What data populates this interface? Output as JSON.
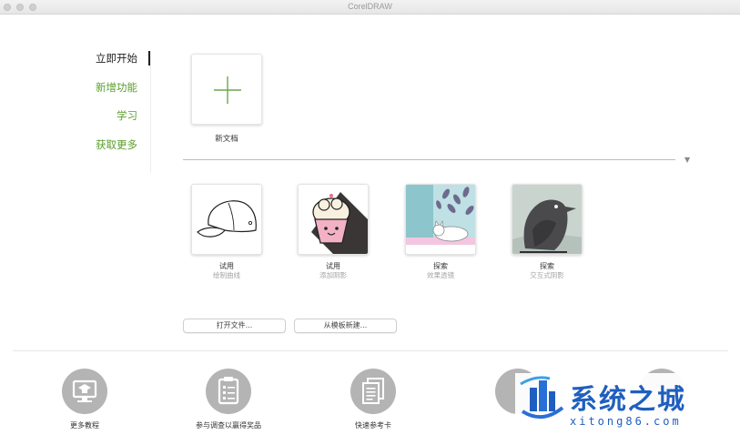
{
  "window": {
    "title": "CorelDRAW"
  },
  "nav": {
    "items": [
      {
        "label": "立即开始",
        "active": true
      },
      {
        "label": "新增功能",
        "active": false
      },
      {
        "label": "学习",
        "active": false
      },
      {
        "label": "获取更多",
        "active": false
      }
    ]
  },
  "new_document": {
    "label": "新文档",
    "icon": "plus-icon",
    "accent": "#6aa84f"
  },
  "tutorials": [
    {
      "label": "试用",
      "sublabel": "绘制曲线",
      "image": "baseball-cap-drawing"
    },
    {
      "label": "试用",
      "sublabel": "添加阴影",
      "image": "cupcake-illustration"
    },
    {
      "label": "探索",
      "sublabel": "效果透镜",
      "image": "sleeping-cat-illustration"
    },
    {
      "label": "探索",
      "sublabel": "交互式阴影",
      "image": "raven-illustration"
    }
  ],
  "buttons": {
    "open_file": "打开文件...",
    "new_from_template": "从模板新建..."
  },
  "resources": [
    {
      "label": "更多教程",
      "icon": "monitor-graduation-icon"
    },
    {
      "label": "参与调查以赢得奖品",
      "icon": "clipboard-icon"
    },
    {
      "label": "快速参考卡",
      "icon": "documents-icon"
    },
    {
      "label": "",
      "icon": "resource-icon"
    },
    {
      "label": "",
      "icon": "resource-icon"
    }
  ],
  "watermark": {
    "title": "系统之城",
    "subtitle": "xitong86.com",
    "color": "#1f5fbf"
  },
  "colors": {
    "accent_green": "#5a9e2c",
    "separator": "#bdbdbd",
    "icon_gray": "#b4b4b4"
  }
}
